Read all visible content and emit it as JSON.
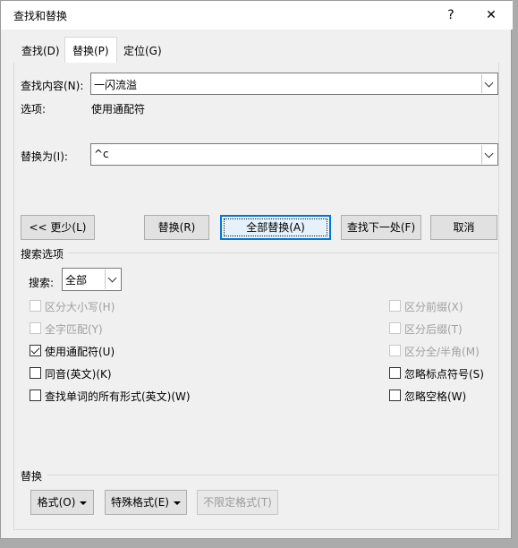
{
  "window": {
    "title": "查找和替换",
    "help_glyph": "?",
    "close_glyph": "✕"
  },
  "tabs": [
    {
      "label": "查找(D)"
    },
    {
      "label": "替换(P)"
    },
    {
      "label": "定位(G)"
    }
  ],
  "find": {
    "label": "查找内容(N):",
    "value": "一闪流溢",
    "options_label": "选项:",
    "options_value": "使用通配符"
  },
  "replace": {
    "label": "替换为(I):",
    "value": "^c"
  },
  "buttons": {
    "less": "<< 更少(L)",
    "replace": "替换(R)",
    "replace_all": "全部替换(A)",
    "find_next": "查找下一处(F)",
    "cancel": "取消"
  },
  "search_options": {
    "section_title": "搜索选项",
    "search_label": "搜索:",
    "search_value": "全部",
    "left": [
      {
        "label": "区分大小写(H)",
        "checked": false,
        "disabled": true
      },
      {
        "label": "全字匹配(Y)",
        "checked": false,
        "disabled": true
      },
      {
        "label": "使用通配符(U)",
        "checked": true,
        "disabled": false
      },
      {
        "label": "同音(英文)(K)",
        "checked": false,
        "disabled": false
      },
      {
        "label": "查找单词的所有形式(英文)(W)",
        "checked": false,
        "disabled": false
      }
    ],
    "right": [
      {
        "label": "区分前缀(X)",
        "checked": false,
        "disabled": true
      },
      {
        "label": "区分后缀(T)",
        "checked": false,
        "disabled": true
      },
      {
        "label": "区分全/半角(M)",
        "checked": false,
        "disabled": true
      },
      {
        "label": "忽略标点符号(S)",
        "checked": false,
        "disabled": false
      },
      {
        "label": "忽略空格(W)",
        "checked": false,
        "disabled": false
      }
    ]
  },
  "replace_section": {
    "title": "替换",
    "format": "格式(O)",
    "special": "特殊格式(E)",
    "no_format": "不限定格式(T)"
  },
  "colors": {
    "accent": "#0078d7",
    "disabled_text": "#a0a0a0"
  }
}
